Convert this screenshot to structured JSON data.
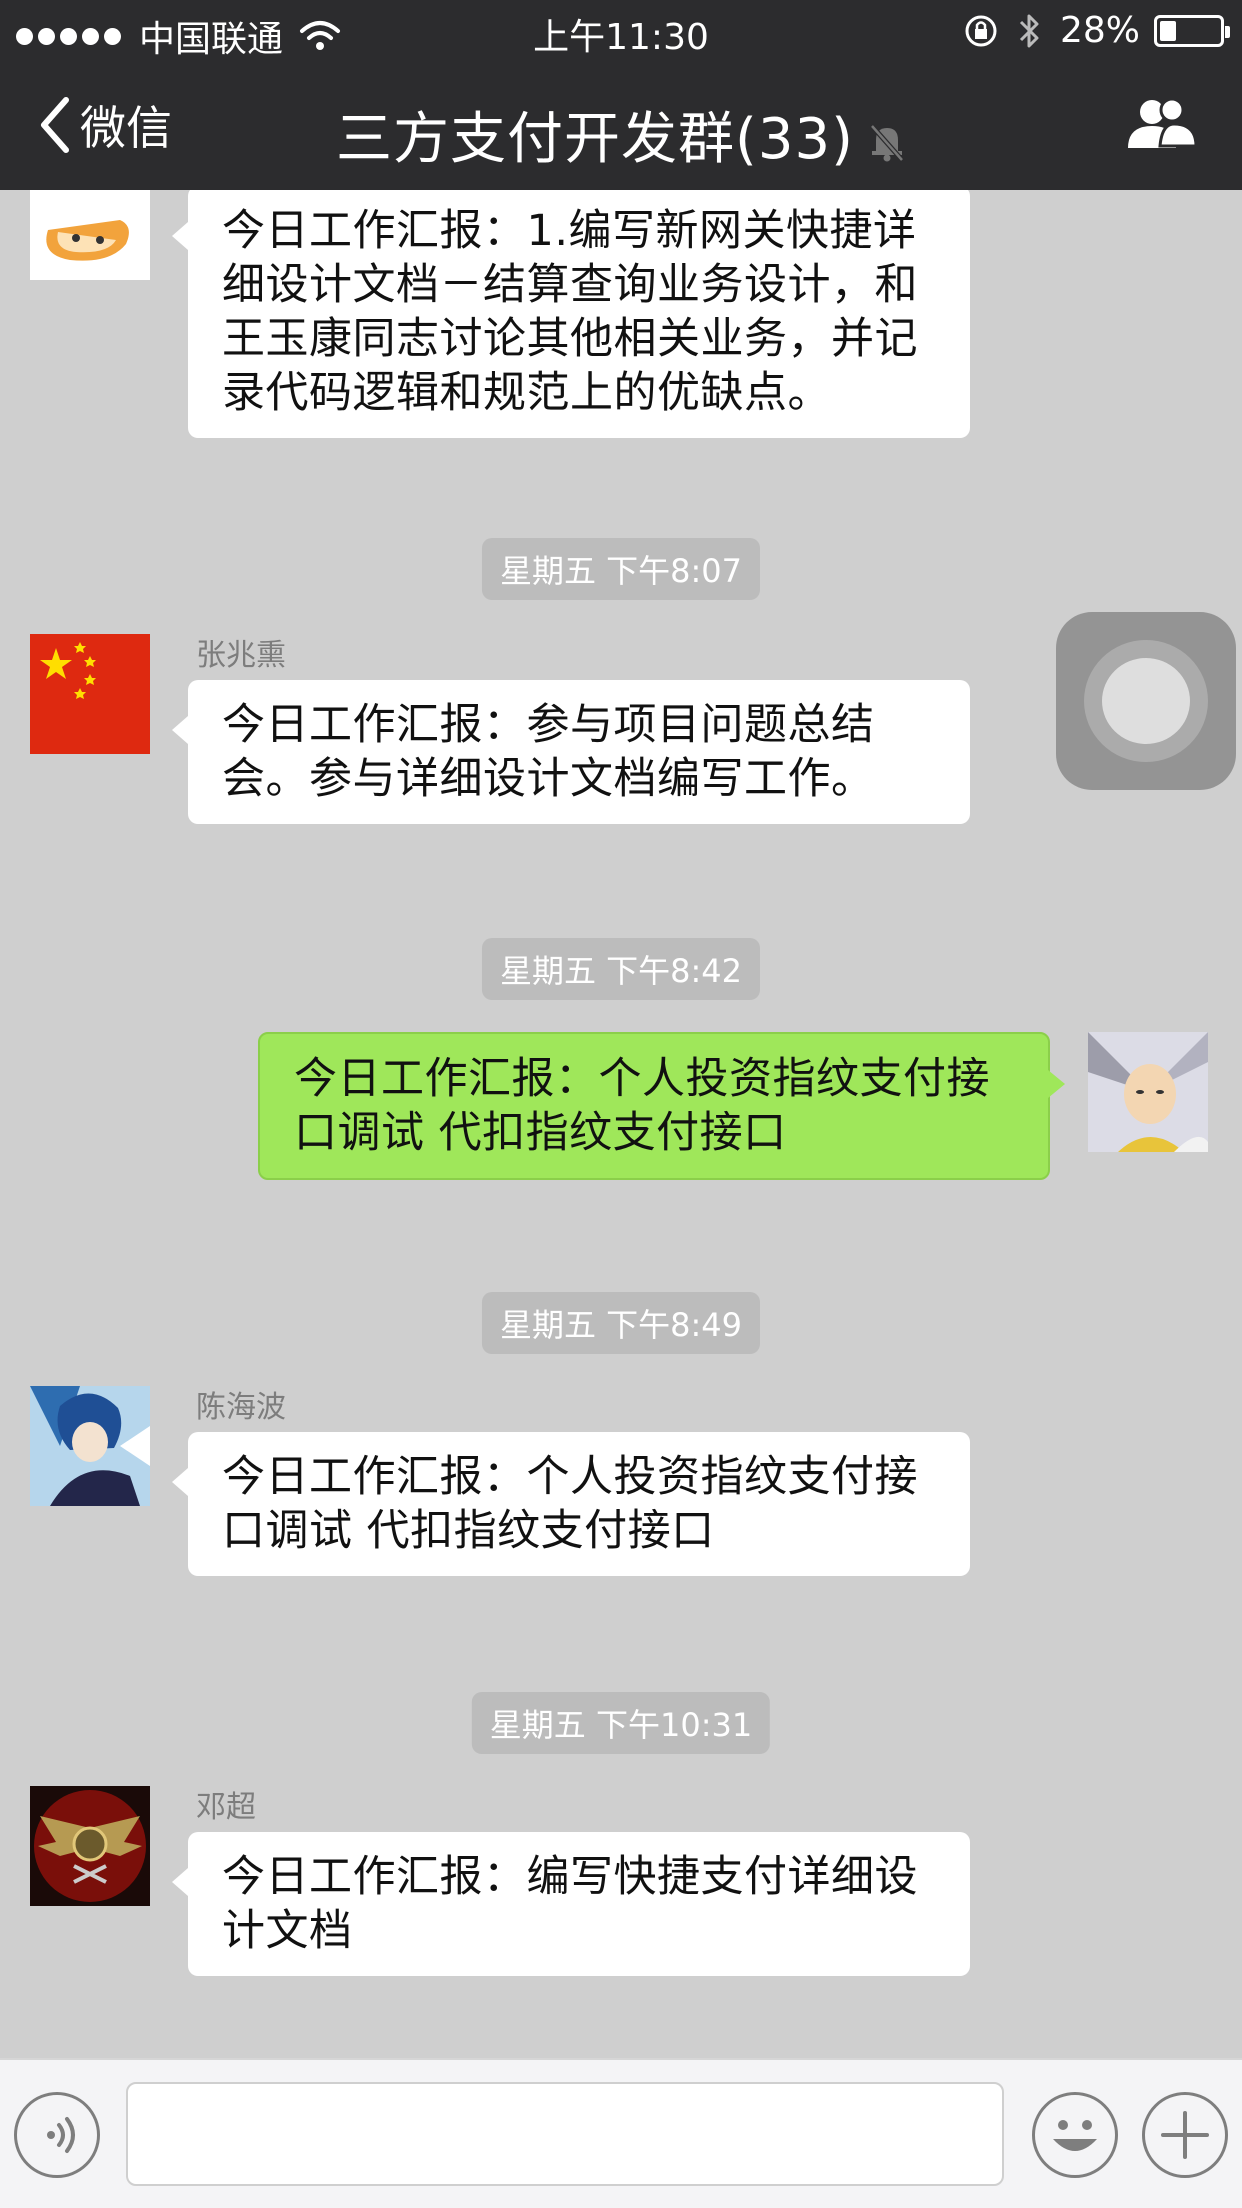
{
  "status_bar": {
    "carrier": "中国联通",
    "time": "上午11:30",
    "battery_percent": "28%",
    "battery_level": 0.28,
    "icons": [
      "signal-dots-icon",
      "wifi-icon",
      "rotation-lock-icon",
      "bluetooth-icon",
      "battery-icon"
    ]
  },
  "nav": {
    "back_label": "微信",
    "title": "三方支付开发群(33)",
    "icons": [
      "chevron-left-icon",
      "mute-bell-icon",
      "group-members-icon"
    ]
  },
  "messages": [
    {
      "sender": "",
      "text": "今日工作汇报：1.编写新网关快捷详细设计文档－结算查询业务设计，和王玉康同志讨论其他相关业务，并记录代码逻辑和规范上的优缺点。",
      "side": "left"
    },
    {
      "timestamp": "星期五 下午8:07"
    },
    {
      "sender": "张兆熏",
      "text": "今日工作汇报：参与项目问题总结会。参与详细设计文档编写工作。",
      "side": "left"
    },
    {
      "timestamp": "星期五 下午8:42"
    },
    {
      "sender": "",
      "text": "今日工作汇报：个人投资指纹支付接口调试 代扣指纹支付接口",
      "side": "right"
    },
    {
      "timestamp": "星期五 下午8:49"
    },
    {
      "sender": "陈海波",
      "text": "今日工作汇报：个人投资指纹支付接口调试 代扣指纹支付接口",
      "side": "left"
    },
    {
      "timestamp": "星期五 下午10:31"
    },
    {
      "sender": "邓超",
      "text": "今日工作汇报：编写快捷支付详细设计文档",
      "side": "left"
    }
  ],
  "input": {
    "value": "",
    "icons": [
      "voice-icon",
      "emoji-icon",
      "plus-icon"
    ]
  },
  "colors": {
    "nav_background": "#2c2c2e",
    "chat_background": "#cfcfcf",
    "own_bubble": "#9fe75a",
    "other_bubble": "#ffffff",
    "timestamp_pill": "#bcbcbc"
  }
}
